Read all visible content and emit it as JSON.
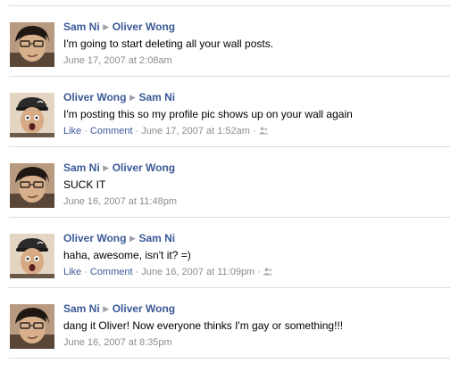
{
  "posts": [
    {
      "author": "Sam Ni",
      "recipient": "Oliver Wong",
      "avatar": "sam",
      "message": "I'm going to start deleting all your wall posts.",
      "timestamp": "June 17, 2007 at 2:08am",
      "show_actions": false
    },
    {
      "author": "Oliver Wong",
      "recipient": "Sam Ni",
      "avatar": "oliver",
      "message": "I'm posting this so my profile pic shows up on your wall again",
      "timestamp": "June 17, 2007 at 1:52am",
      "show_actions": true
    },
    {
      "author": "Sam Ni",
      "recipient": "Oliver Wong",
      "avatar": "sam",
      "message": "SUCK IT",
      "timestamp": "June 16, 2007 at 11:48pm",
      "show_actions": false
    },
    {
      "author": "Oliver Wong",
      "recipient": "Sam Ni",
      "avatar": "oliver",
      "message": "haha, awesome, isn't it? =)",
      "timestamp": "June 16, 2007 at 11:09pm",
      "show_actions": true
    },
    {
      "author": "Sam Ni",
      "recipient": "Oliver Wong",
      "avatar": "sam",
      "message": "dang it Oliver! Now everyone thinks I'm gay or something!!!",
      "timestamp": "June 16, 2007 at 8:35pm",
      "show_actions": false
    }
  ],
  "actions": {
    "like_label": "Like",
    "comment_label": "Comment",
    "separator": "·",
    "privacy_icon": "people-icon"
  },
  "colors": {
    "name_link": "#3b5998",
    "meta_text": "#8c8c8c",
    "divider": "#dcdcdc"
  }
}
